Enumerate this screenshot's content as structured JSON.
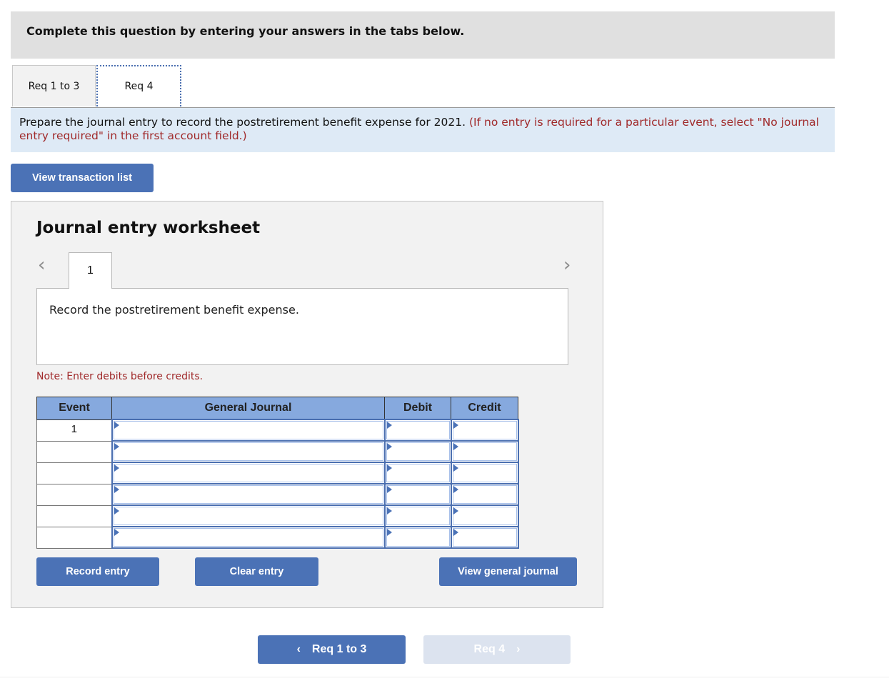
{
  "header": {
    "title": "Complete this question by entering your answers in the tabs below."
  },
  "tabs": [
    {
      "label": "Req 1 to 3",
      "active": false
    },
    {
      "label": "Req 4",
      "active": true
    }
  ],
  "instructions": {
    "main": "Prepare the journal entry to record the postretirement benefit expense for 2021.",
    "hint": "(If no entry is required for a particular event, select \"No journal entry required\" in the first account field.)"
  },
  "buttons": {
    "view_transaction_list": "View transaction list",
    "record_entry": "Record entry",
    "clear_entry": "Clear entry",
    "view_general_journal": "View general journal"
  },
  "worksheet": {
    "title": "Journal entry worksheet",
    "entry_tab": "1",
    "prev_icon": "‹",
    "next_icon": "›",
    "description": "Record the postretirement benefit expense.",
    "note": "Note: Enter debits before credits."
  },
  "table": {
    "headers": [
      "Event",
      "General Journal",
      "Debit",
      "Credit"
    ],
    "rows": [
      {
        "event": "1",
        "account": "",
        "debit": "",
        "credit": ""
      },
      {
        "event": "",
        "account": "",
        "debit": "",
        "credit": ""
      },
      {
        "event": "",
        "account": "",
        "debit": "",
        "credit": ""
      },
      {
        "event": "",
        "account": "",
        "debit": "",
        "credit": ""
      },
      {
        "event": "",
        "account": "",
        "debit": "",
        "credit": ""
      },
      {
        "event": "",
        "account": "",
        "debit": "",
        "credit": ""
      }
    ]
  },
  "nav": {
    "prev_label": "Req 1 to 3",
    "next_label": "Req 4",
    "prev_icon": "‹",
    "next_icon": "›"
  },
  "colors": {
    "accent": "#4b72b6",
    "header_bg": "#e0e0e0",
    "instruction_bg": "#deeaf6",
    "hint_text": "#a0292a",
    "table_header": "#86a9de",
    "disabled_button": "#dce3ef"
  }
}
